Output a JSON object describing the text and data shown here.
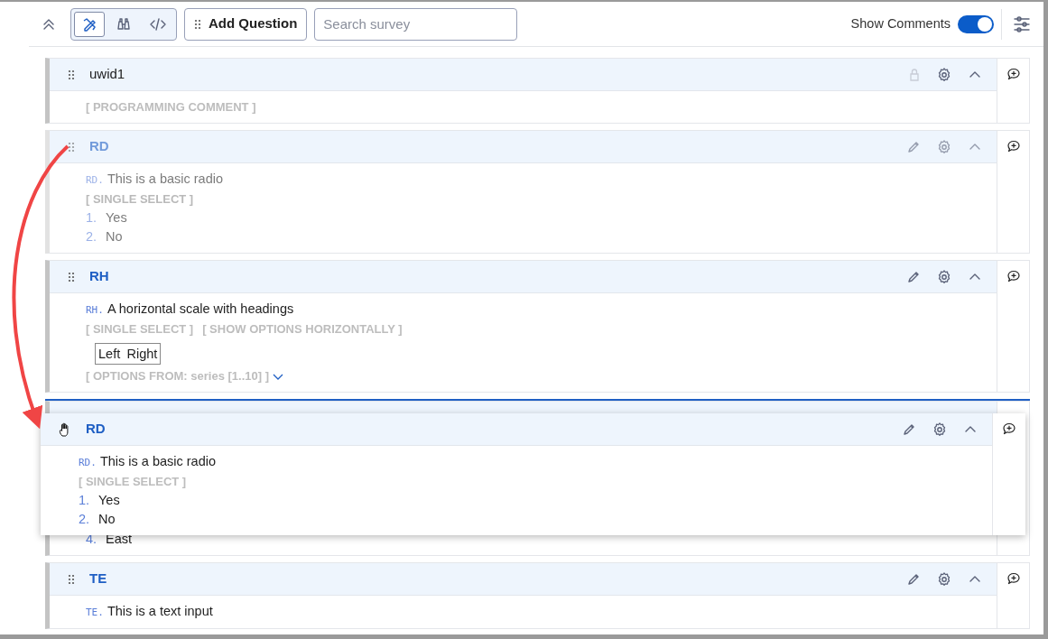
{
  "toolbar": {
    "view_modes": [
      {
        "kind": "design",
        "selected": true
      },
      {
        "kind": "preview",
        "selected": false
      },
      {
        "kind": "code",
        "selected": false
      }
    ],
    "add_button": "Add Question",
    "search": {
      "placeholder": "Search survey"
    },
    "show_comments": {
      "label": "Show Comments",
      "on": true
    }
  },
  "questions": [
    {
      "id": "uwid1",
      "locked": true,
      "faded": false,
      "drop_target": false,
      "tags": [
        "[ PROGRAMMING COMMENT ]"
      ]
    },
    {
      "id": "RD",
      "locked": false,
      "faded": true,
      "drop_target": false,
      "prefix": "RD.",
      "text": "This is a basic radio",
      "tags": [
        "[ SINGLE SELECT ]"
      ],
      "options": [
        {
          "number": "1.",
          "label": "Yes"
        },
        {
          "number": "2.",
          "label": "No"
        }
      ]
    },
    {
      "id": "RH",
      "locked": false,
      "faded": false,
      "drop_target": false,
      "prefix": "RH.",
      "text": "A horizontal scale with headings",
      "tags": [
        "[ SINGLE SELECT ]",
        "[ SHOW OPTIONS HORIZONTALLY ]"
      ],
      "scale": [
        "Left",
        "Right"
      ],
      "options_from": "[ OPTIONS FROM: series [1..10] ]"
    },
    {
      "faded": false,
      "drop_target": true,
      "options": [
        {
          "number": "4.",
          "label": "East"
        }
      ]
    },
    {
      "id": "TE",
      "locked": false,
      "faded": false,
      "drop_target": false,
      "prefix": "TE.",
      "text": "This is a text input"
    }
  ],
  "dragged": {
    "id": "RD",
    "prefix": "RD.",
    "text": "This is a basic radio",
    "tags": [
      "[ SINGLE SELECT ]"
    ],
    "options": [
      {
        "number": "1.",
        "label": "Yes"
      },
      {
        "number": "2.",
        "label": "No"
      }
    ]
  }
}
